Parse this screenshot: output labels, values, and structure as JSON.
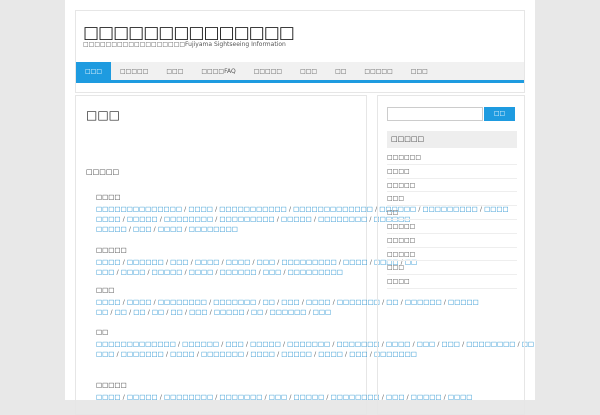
{
  "header": {
    "title": "□□□□□□□□□□□□□□",
    "tagline": "□□□□□□□□□□□□□□□□□□Fujiyama Sightseeing Information"
  },
  "nav": [
    "□□□",
    "□□□□□",
    "□□□",
    "□□□□FAQ",
    "□□□□□",
    "□□□",
    "□□",
    "□□□□□",
    "□□□"
  ],
  "main": {
    "page_title": "□□□",
    "sitemap_heading": "□□□□□",
    "groups": [
      {
        "title": "□□□□",
        "lines": [
          [
            "□□□□□□□□□□□□□□",
            "□□□□",
            "□□□□□□□□□□□",
            "□□□□□□□□□□□□□",
            "□□□□□□",
            "□□□□□□□□□",
            "□□□□"
          ],
          [
            "□□□□",
            "□□□□□",
            "□□□□□□□□",
            "□□□□□□□□□",
            "□□□□□",
            "□□□□□□□□",
            "□□□□□□"
          ],
          [
            "□□□□□",
            "□□□",
            "□□□□",
            "□□□□□□□□"
          ]
        ]
      },
      {
        "title": "□□□□□",
        "lines": [
          [
            "□□□□",
            "□□□□□□",
            "□□□",
            "□□□□",
            "□□□□",
            "□□□",
            "□□□□□□□□□",
            "□□□□",
            "□□□□",
            "□□"
          ],
          [
            "□□□",
            "□□□□",
            "□□□□□",
            "□□□□",
            "□□□□□□",
            "□□□",
            "□□□□□□□□□"
          ]
        ]
      },
      {
        "title": "□□□",
        "lines": [
          [
            "□□□□",
            "□□□□",
            "□□□□□□□□",
            "□□□□□□□",
            "□□",
            "□□□",
            "□□□□",
            "□□□□□□□",
            "□□",
            "□□□□□□",
            "□□□□□"
          ],
          [
            "□□",
            "□□",
            "□□",
            "□□",
            "□□",
            "□□□",
            "□□□□□",
            "□□",
            "□□□□□□",
            "□□□"
          ]
        ]
      },
      {
        "title": "□□",
        "lines": [
          [
            "□□□□□□□□□□□□□",
            "□□□□□□",
            "□□□",
            "□□□□□",
            "□□□□□□□",
            "□□□□□□□",
            "□□□□",
            "□□□",
            "□□□",
            "□□□□□□□□",
            "□□"
          ],
          [
            "□□□",
            "□□□□□□□",
            "□□□□",
            "□□□□□□□",
            "□□□□",
            "□□□□□",
            "□□□□",
            "□□□",
            "□□□□□□□"
          ]
        ]
      },
      {
        "title": "□□□□□",
        "lines": [
          [
            "□□□□",
            "□□□□□",
            "□□□□□□□□",
            "□□□□□□□",
            "□□□",
            "□□□□□",
            "□□□□□□□□",
            "□□□",
            "□□□□□",
            "□□□□"
          ]
        ]
      }
    ]
  },
  "sidebar": {
    "search_placeholder": "",
    "search_button": "□□",
    "widget_title": "□□□□□",
    "categories": [
      "□□□□□□",
      "□□□□",
      "□□□□□",
      "□□□",
      "□□",
      "□□□□□",
      "□□□□□",
      "□□□□□",
      "□□□",
      "□□□□"
    ]
  }
}
